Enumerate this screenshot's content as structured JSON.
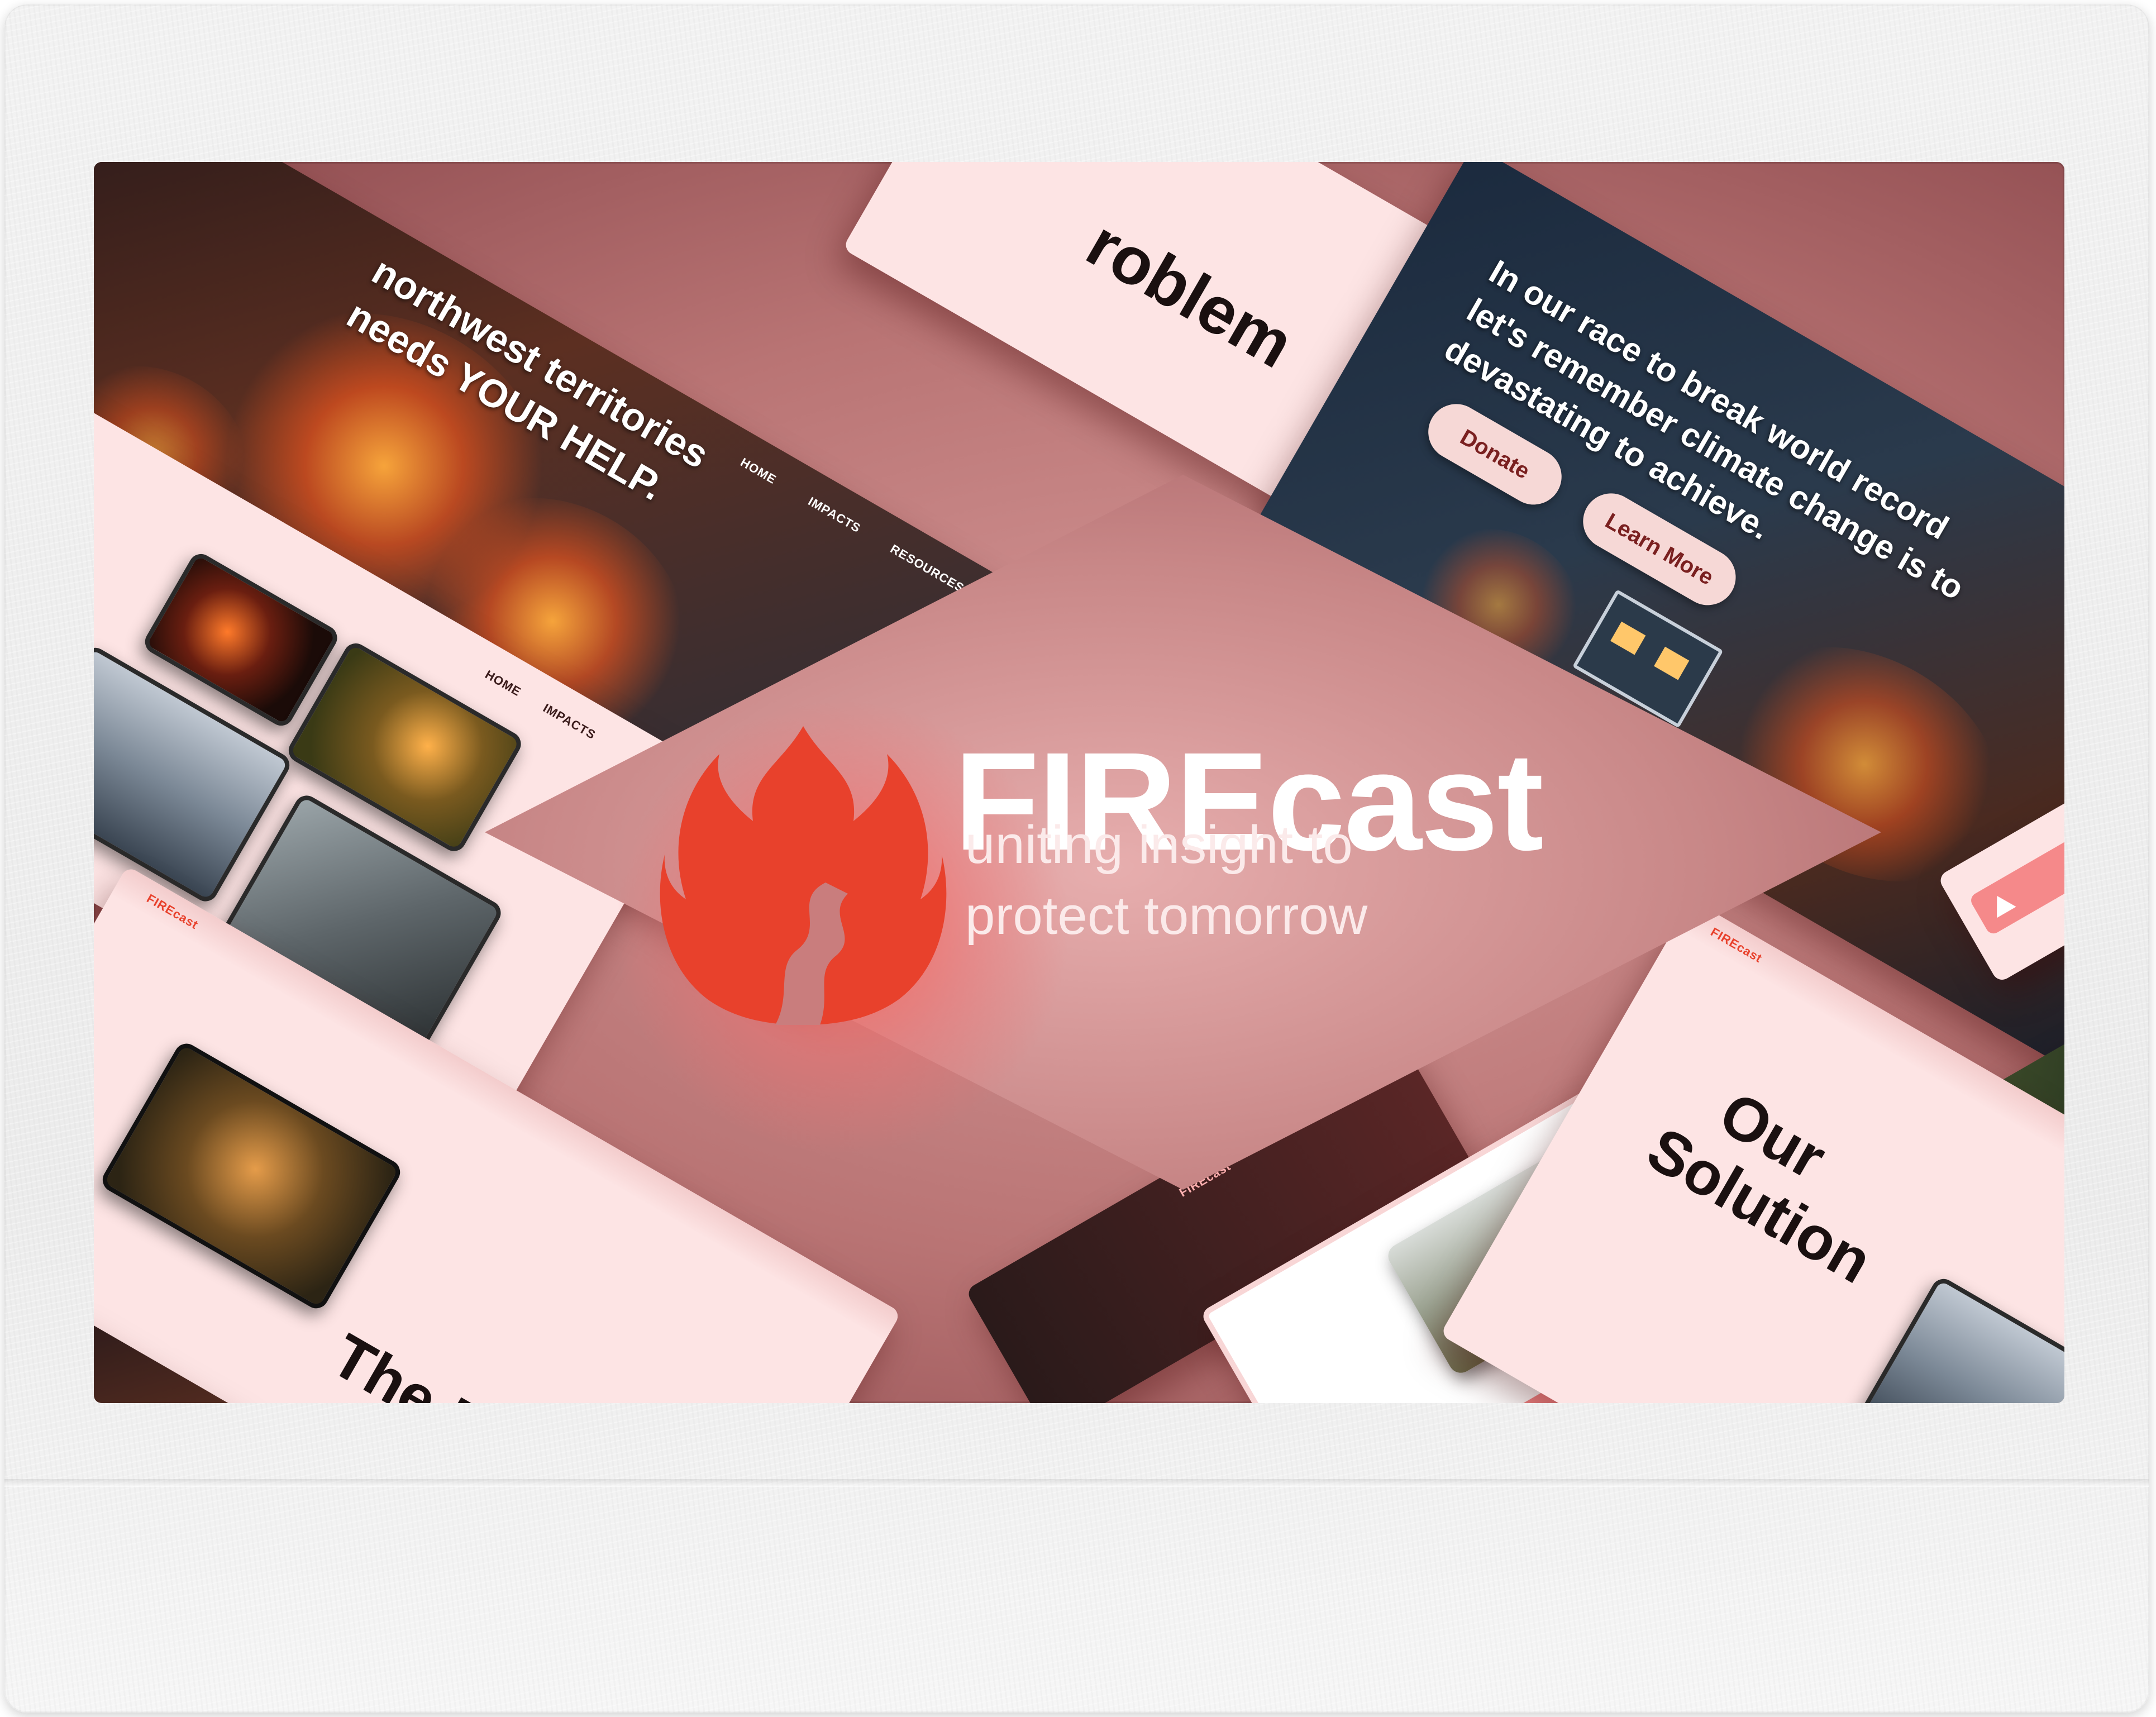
{
  "brand": {
    "title": "FIREcast",
    "tagline_line1": "uniting insight to",
    "tagline_line2": "protect tomorrow",
    "accent_color": "#e8412c",
    "logo_icon": "flame-road-icon"
  },
  "slides": {
    "hero_territories": {
      "headline_line1": "northwest territories",
      "headline_line2": "needs YOUR HELP."
    },
    "hero_climate": {
      "headline_line1": "In our race to break world record",
      "headline_line2": "let's remember climate change is to",
      "headline_line3": "devastating to achieve.",
      "donate_label": "Donate",
      "learn_more_label": "Learn More"
    },
    "problem_top": {
      "title": "roblem"
    },
    "problem_bottom": {
      "title": "The Problem",
      "logo_text": "FIREcast"
    },
    "solution": {
      "title_line1": "Our",
      "title_line2": "Solution",
      "logo_text": "FIREcast"
    },
    "bottom_strip": {
      "logo_text": "FIREcast"
    }
  }
}
